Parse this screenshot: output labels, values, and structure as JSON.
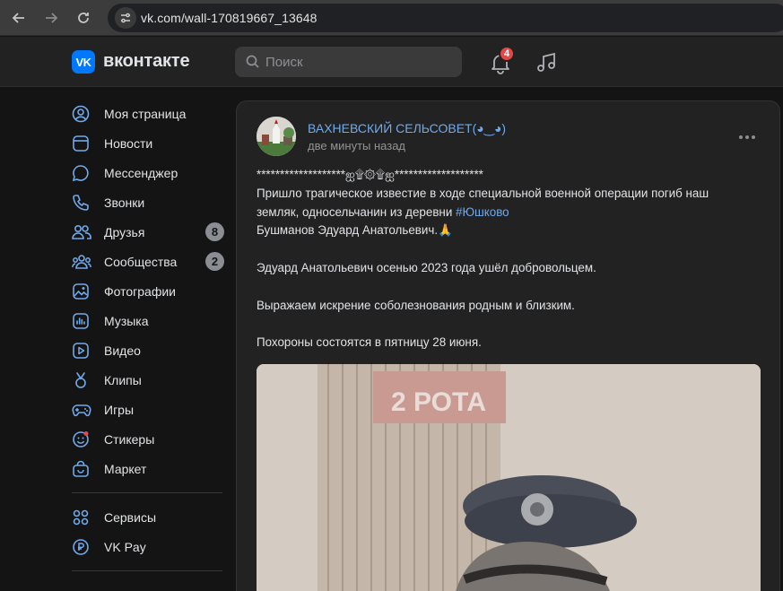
{
  "browser": {
    "url": "vk.com/wall-170819667_13648",
    "icons": [
      "back-icon",
      "forward-icon",
      "reload-icon",
      "site-settings-icon"
    ]
  },
  "header": {
    "logo_text": "VK",
    "brand": "вконтакте",
    "search_placeholder": "Поиск",
    "notifications_count": "4",
    "accent_color": "#0077ff",
    "badge_color": "#e64646"
  },
  "sidebar": {
    "items": [
      {
        "label": "Моя страница",
        "icon": "user-circle-icon"
      },
      {
        "label": "Новости",
        "icon": "news-icon"
      },
      {
        "label": "Мессенджер",
        "icon": "message-icon"
      },
      {
        "label": "Звонки",
        "icon": "phone-icon"
      },
      {
        "label": "Друзья",
        "icon": "friends-icon",
        "count": "8"
      },
      {
        "label": "Сообщества",
        "icon": "communities-icon",
        "count": "2"
      },
      {
        "label": "Фотографии",
        "icon": "photos-icon"
      },
      {
        "label": "Музыка",
        "icon": "music-icon"
      },
      {
        "label": "Видео",
        "icon": "video-icon"
      },
      {
        "label": "Клипы",
        "icon": "clips-icon"
      },
      {
        "label": "Игры",
        "icon": "games-icon"
      },
      {
        "label": "Стикеры",
        "icon": "stickers-icon"
      },
      {
        "label": "Маркет",
        "icon": "market-icon"
      }
    ],
    "extra_items": [
      {
        "label": "Сервисы",
        "icon": "services-icon"
      },
      {
        "label": "VK Pay",
        "icon": "vk-pay-icon"
      }
    ]
  },
  "post": {
    "author": "ВАХНЕВСКИЙ СЕЛЬСОВЕТ(◕‿◕)",
    "time": "две минуты назад",
    "line1": "*******************ஐ۩۞۩ஐ*******************",
    "line2": "Пришло трагическое известие в ходе специальной военной операции погиб наш",
    "line3_prefix": "земляк, односельчанин из деревни ",
    "hashtag": "#Юшково",
    "line4": "Бушманов Эдуард Анатольевич.🙏",
    "line5": "Эдуард Анатольевич осенью 2023 года ушёл добровольцем.",
    "line6": "Выражаем искрение соболезнования родным и близким.",
    "line7": "Похороны состоятся в пятницу 28 июня.",
    "photo_sign": "2 РОТА"
  }
}
